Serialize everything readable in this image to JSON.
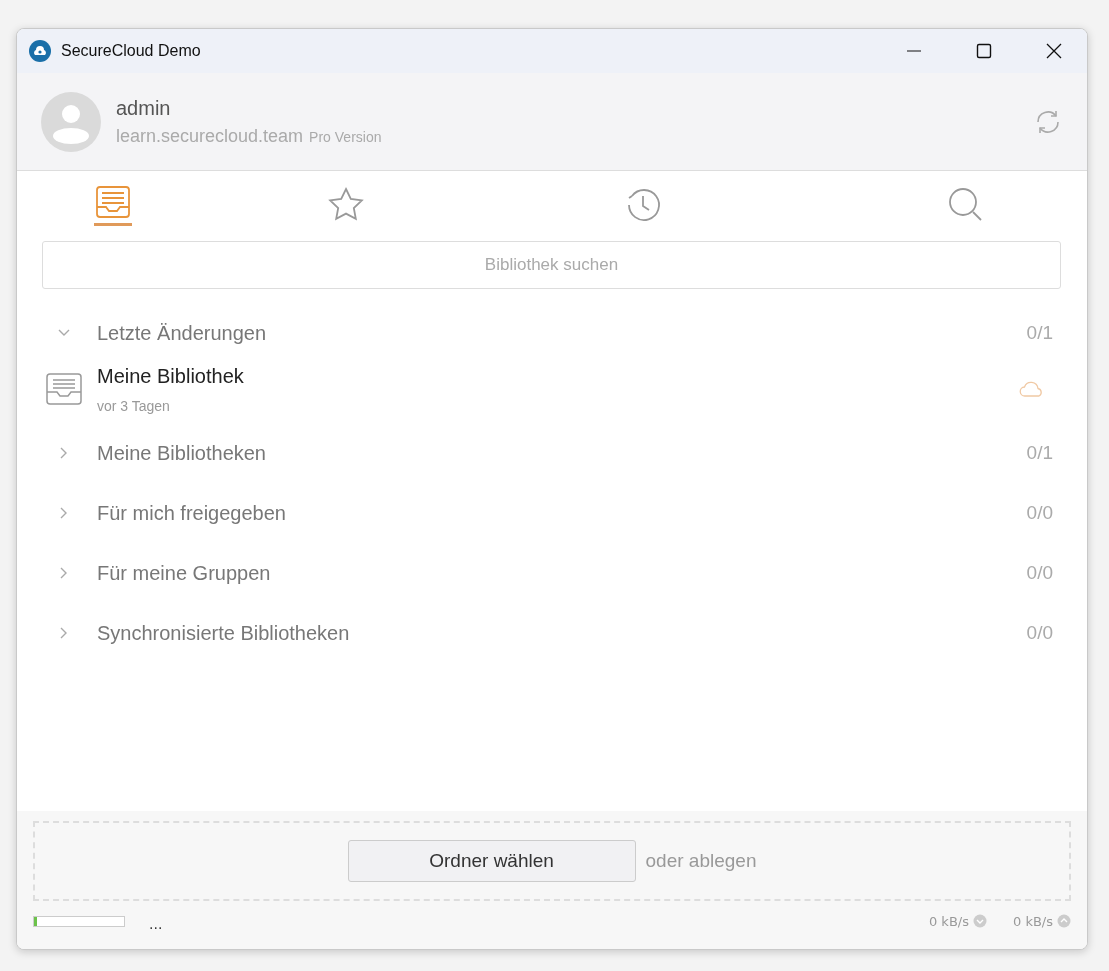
{
  "window": {
    "title": "SecureCloud Demo"
  },
  "account": {
    "name": "admin",
    "server": "learn.securecloud.team",
    "edition": "Pro Version"
  },
  "tabs": [
    {
      "kind": "library",
      "selected": true
    },
    {
      "kind": "starred",
      "selected": false
    },
    {
      "kind": "recent",
      "selected": false
    },
    {
      "kind": "search",
      "selected": false
    }
  ],
  "search": {
    "placeholder": "Bibliothek suchen"
  },
  "groups": [
    {
      "label": "Letzte Änderungen",
      "count": "0/1",
      "expanded": true,
      "children": [
        {
          "name": "Meine Bibliothek",
          "time": "vor 3 Tagen"
        }
      ]
    },
    {
      "label": "Meine Bibliotheken",
      "count": "0/1",
      "expanded": false
    },
    {
      "label": "Für mich freigegeben",
      "count": "0/0",
      "expanded": false
    },
    {
      "label": "Für meine Gruppen",
      "count": "0/0",
      "expanded": false
    },
    {
      "label": "Synchronisierte Bibliotheken",
      "count": "0/0",
      "expanded": false
    }
  ],
  "drop_zone": {
    "button": "Ordner wählen",
    "hint": "oder ablegen"
  },
  "status_bar": {
    "level": 0.03,
    "status": "...",
    "download": "0 kB/s",
    "upload": "0 kB/s"
  }
}
